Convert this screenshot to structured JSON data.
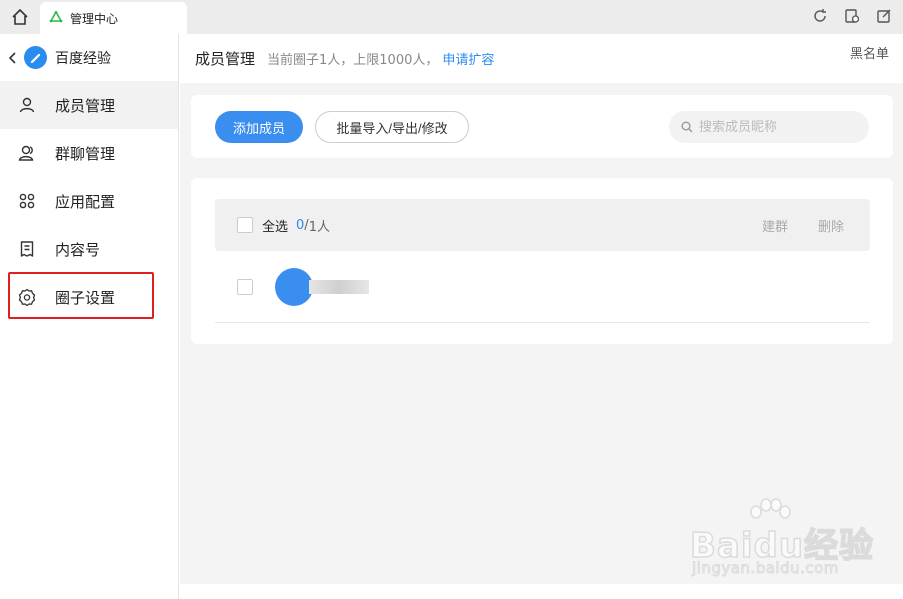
{
  "tab": {
    "label": "管理中心"
  },
  "sidebar": {
    "title": "百度经验",
    "items": [
      {
        "label": "成员管理",
        "icon": "person-icon",
        "active": true
      },
      {
        "label": "群聊管理",
        "icon": "group-icon",
        "active": false
      },
      {
        "label": "应用配置",
        "icon": "apps-icon",
        "active": false
      },
      {
        "label": "内容号",
        "icon": "document-icon",
        "active": false
      },
      {
        "label": "圈子设置",
        "icon": "gear-icon",
        "active": false
      }
    ]
  },
  "header": {
    "title": "成员管理",
    "subtitle": "当前圈子1人，上限1000人，",
    "apply_link": "申请扩容",
    "blacklist": "黑名单"
  },
  "toolbar": {
    "add_label": "添加成员",
    "batch_label": "批量导入/导出/修改",
    "search_placeholder": "搜索成员昵称"
  },
  "list": {
    "select_all": "全选",
    "selected_count": "0",
    "separator": "/",
    "total": "1人",
    "action_group": "建群",
    "action_delete": "删除"
  },
  "watermark": {
    "brand": "Baidu经验",
    "url": "jingyan.baidu.com"
  },
  "colors": {
    "accent": "#2b8cf0",
    "highlight": "#e02020"
  }
}
